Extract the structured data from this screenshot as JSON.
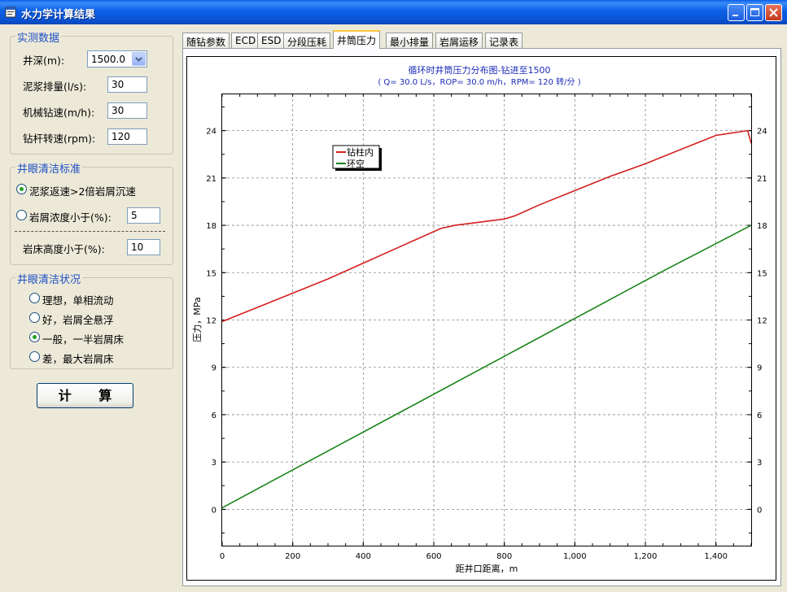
{
  "window": {
    "title": "水力学计算结果"
  },
  "measured": {
    "legend": "实测数据",
    "depth_label": "井深(m):",
    "depth_value": "1500.0",
    "flow_label": "泥浆排量(l/s):",
    "flow_value": "30",
    "rop_label": "机械钻速(m/h):",
    "rop_value": "30",
    "rpm_label": "钻杆转速(rpm):",
    "rpm_value": "120"
  },
  "criteria": {
    "legend": "井眼清洁标准",
    "option1": "泥浆返速>2倍岩屑沉速",
    "option2": "岩屑浓度小于(%):",
    "option2_value": "5",
    "bed_label": "岩床高度小于(%):",
    "bed_value": "10",
    "selected": "option1"
  },
  "status": {
    "legend": "井眼清洁状况",
    "options": [
      "理想，单相流动",
      "好，岩屑全悬浮",
      "一般，一半岩屑床",
      "差，最大岩屑床"
    ],
    "selected_index": 2
  },
  "calc_button": "计 算",
  "tabs": [
    "随钻参数",
    "ECD",
    "ESD",
    "分段压耗",
    "井筒压力",
    "最小排量",
    "岩屑运移",
    "记录表"
  ],
  "active_tab": 4,
  "chart_data": {
    "type": "line",
    "title": "循环时井筒压力分布图-钻进至1500",
    "subtitle": "( Q= 30.0 L/s，ROP= 30.0 m/h，RPM= 120 转/分 )",
    "xlabel": "距井口距离，m",
    "ylabel": "压力，MPa",
    "xlim": [
      0,
      1500
    ],
    "ylim": [
      -2.3,
      26.3
    ],
    "xticks": [
      0,
      200,
      400,
      600,
      800,
      1000,
      1200,
      1400
    ],
    "xtick_labels": [
      "0",
      "200",
      "400",
      "600",
      "800",
      "1,000",
      "1,200",
      "1,400"
    ],
    "yticks": [
      0,
      3,
      6,
      9,
      12,
      15,
      18,
      21,
      24
    ],
    "grid": true,
    "legend_position": "top-left",
    "series": [
      {
        "name": "钻柱内",
        "color": "#d42020",
        "x": [
          0,
          100,
          200,
          300,
          400,
          500,
          620,
          660,
          800,
          830,
          900,
          1000,
          1100,
          1200,
          1300,
          1400,
          1490,
          1500
        ],
        "y": [
          11.9,
          12.8,
          13.7,
          14.6,
          15.6,
          16.6,
          17.8,
          18.0,
          18.4,
          18.6,
          19.3,
          20.2,
          21.1,
          21.9,
          22.8,
          23.7,
          24.0,
          23.2
        ]
      },
      {
        "name": "环空",
        "color": "#188418",
        "x": [
          0,
          250,
          500,
          750,
          1000,
          1250,
          1500
        ],
        "y": [
          0.1,
          3.1,
          6.1,
          9.1,
          12.1,
          15.1,
          18.0
        ]
      }
    ]
  }
}
